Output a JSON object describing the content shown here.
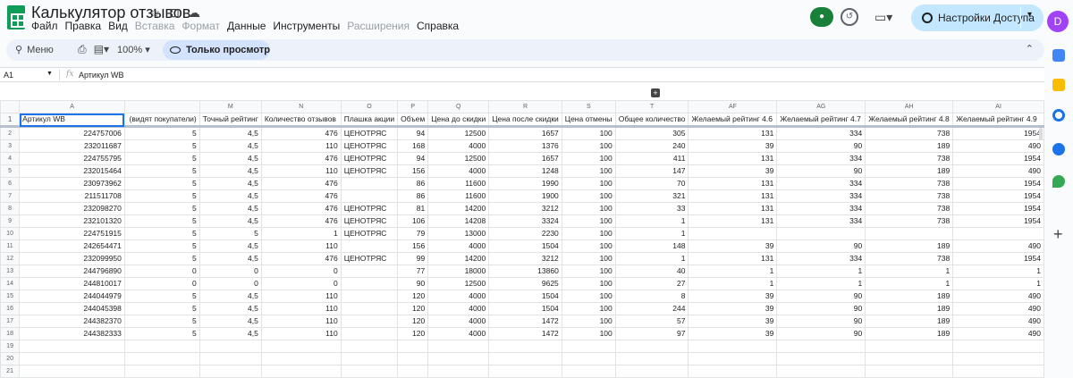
{
  "app": {
    "title": "Калькулятор отзывов",
    "menu": [
      "Файл",
      "Правка",
      "Вид",
      "Вставка",
      "Формат",
      "Данные",
      "Инструменты",
      "Расширения",
      "Справка"
    ],
    "menu_disabled": [
      false,
      false,
      false,
      true,
      true,
      false,
      false,
      true,
      false
    ],
    "share_label": "Настройки Доступа",
    "avatar_letter": "D"
  },
  "toolbar": {
    "search_label": "Меню",
    "zoom": "100%",
    "view_mode": "Только просмотр"
  },
  "formula_bar": {
    "cell_ref": "A1",
    "fx": "fx",
    "content": "Артикул WB"
  },
  "sheet": {
    "columns": [
      "A",
      "",
      "M",
      "N",
      "O",
      "P",
      "Q",
      "R",
      "S",
      "T",
      "AF",
      "AG",
      "AH",
      "AI"
    ],
    "header_row": [
      "Артикул WB",
      "(видят покупатели)",
      "Точный рейтинг",
      "Количество отзывов",
      "Плашка акции",
      "Объем",
      "Цена до скидки",
      "Цена после скидки",
      "Цена отмены",
      "Общее количество",
      "Желаемый рейтинг 4.6",
      "Желаемый рейтинг 4.7",
      "Желаемый рейтинг 4.8",
      "Желаемый рейтинг 4.9"
    ],
    "rows": [
      [
        "224757006",
        "5",
        "4,5",
        "476",
        "ЦЕНОТРЯС",
        "94",
        "12500",
        "1657",
        "100",
        "305",
        "131",
        "334",
        "738",
        "1954"
      ],
      [
        "232011687",
        "5",
        "4,5",
        "110",
        "ЦЕНОТРЯС",
        "168",
        "4000",
        "1376",
        "100",
        "240",
        "39",
        "90",
        "189",
        "490"
      ],
      [
        "224755795",
        "5",
        "4,5",
        "476",
        "ЦЕНОТРЯС",
        "94",
        "12500",
        "1657",
        "100",
        "411",
        "131",
        "334",
        "738",
        "1954"
      ],
      [
        "232015464",
        "5",
        "4,5",
        "110",
        "ЦЕНОТРЯС",
        "156",
        "4000",
        "1248",
        "100",
        "147",
        "39",
        "90",
        "189",
        "490"
      ],
      [
        "230973962",
        "5",
        "4,5",
        "476",
        "",
        "86",
        "11600",
        "1990",
        "100",
        "70",
        "131",
        "334",
        "738",
        "1954"
      ],
      [
        "211511708",
        "5",
        "4,5",
        "476",
        "",
        "86",
        "11600",
        "1900",
        "100",
        "321",
        "131",
        "334",
        "738",
        "1954"
      ],
      [
        "232098270",
        "5",
        "4,5",
        "476",
        "ЦЕНОТРЯС",
        "81",
        "14200",
        "3212",
        "100",
        "33",
        "131",
        "334",
        "738",
        "1954"
      ],
      [
        "232101320",
        "5",
        "4,5",
        "476",
        "ЦЕНОТРЯС",
        "106",
        "14208",
        "3324",
        "100",
        "1",
        "131",
        "334",
        "738",
        "1954"
      ],
      [
        "224751915",
        "5",
        "5",
        "1",
        "ЦЕНОТРЯС",
        "79",
        "13000",
        "2230",
        "100",
        "1",
        "",
        "",
        "",
        ""
      ],
      [
        "242654471",
        "5",
        "4,5",
        "110",
        "",
        "156",
        "4000",
        "1504",
        "100",
        "148",
        "39",
        "90",
        "189",
        "490"
      ],
      [
        "232099950",
        "5",
        "4,5",
        "476",
        "ЦЕНОТРЯС",
        "99",
        "14200",
        "3212",
        "100",
        "1",
        "131",
        "334",
        "738",
        "1954"
      ],
      [
        "244796890",
        "0",
        "0",
        "0",
        "",
        "77",
        "18000",
        "13860",
        "100",
        "40",
        "1",
        "1",
        "1",
        "1"
      ],
      [
        "244810017",
        "0",
        "0",
        "0",
        "",
        "90",
        "12500",
        "9625",
        "100",
        "27",
        "1",
        "1",
        "1",
        "1"
      ],
      [
        "244044979",
        "5",
        "4,5",
        "110",
        "",
        "120",
        "4000",
        "1504",
        "100",
        "8",
        "39",
        "90",
        "189",
        "490"
      ],
      [
        "244045398",
        "5",
        "4,5",
        "110",
        "",
        "120",
        "4000",
        "1504",
        "100",
        "244",
        "39",
        "90",
        "189",
        "490"
      ],
      [
        "244382370",
        "5",
        "4,5",
        "110",
        "",
        "120",
        "4000",
        "1472",
        "100",
        "57",
        "39",
        "90",
        "189",
        "490"
      ],
      [
        "244382333",
        "5",
        "4,5",
        "110",
        "",
        "120",
        "4000",
        "1472",
        "100",
        "97",
        "39",
        "90",
        "189",
        "490"
      ],
      [
        "",
        "",
        "",
        "",
        "",
        "",
        "",
        "",
        "",
        "",
        "",
        "",
        "",
        ""
      ],
      [
        "",
        "",
        "",
        "",
        "",
        "",
        "",
        "",
        "",
        "",
        "",
        "",
        "",
        ""
      ],
      [
        "",
        "",
        "",
        "",
        "",
        "",
        "",
        "",
        "",
        "",
        "",
        "",
        "",
        ""
      ]
    ]
  },
  "colors": {
    "accent": "#1a73e8",
    "share_bg": "#c2e7ff",
    "sheets_green": "#0f9d58",
    "avatar": "#a142f4"
  }
}
